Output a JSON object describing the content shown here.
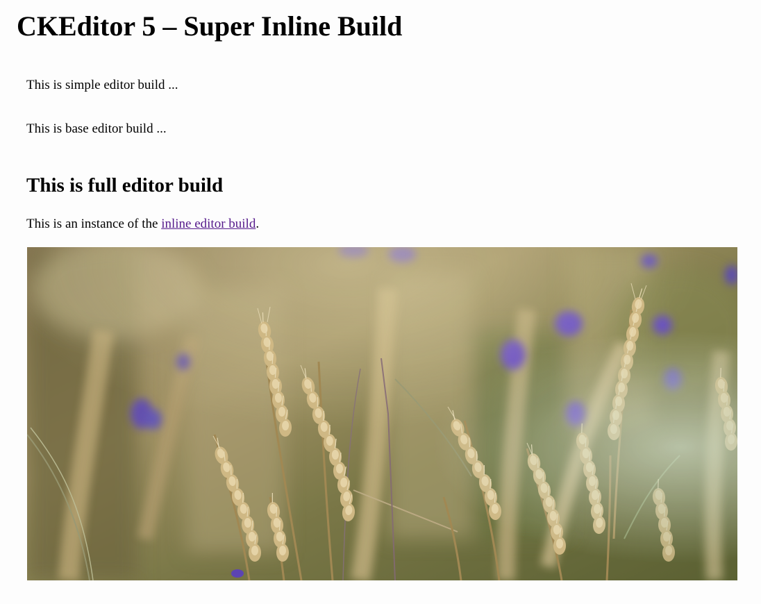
{
  "page": {
    "title": "CKEditor 5 – Super Inline Build"
  },
  "editors": {
    "simple": {
      "text": "This is simple editor build ..."
    },
    "base": {
      "text": "This is base editor build ..."
    },
    "full": {
      "heading": "This is full editor build",
      "paragraph_before": "This is an instance of the ",
      "link_text": "inline editor build",
      "paragraph_after": ".",
      "image": {
        "subject": "wheat field photo"
      }
    }
  },
  "colors": {
    "link": "#551a8b",
    "text": "#000000",
    "background": "#fdfdfd"
  }
}
